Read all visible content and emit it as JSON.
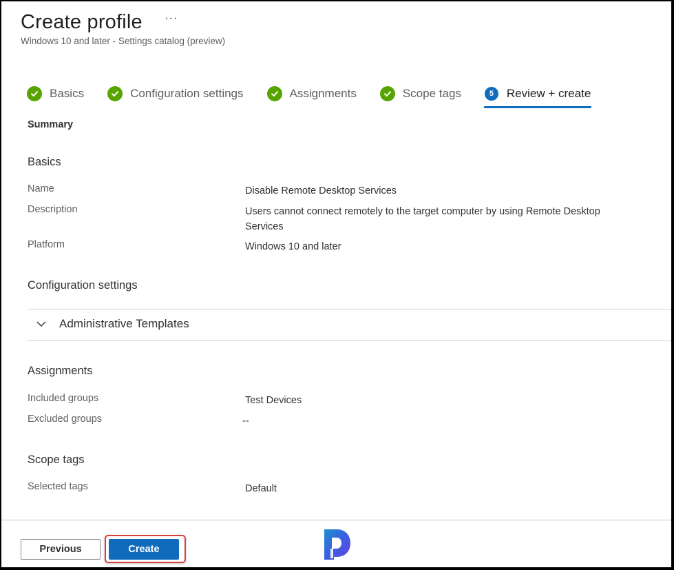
{
  "header": {
    "title": "Create profile",
    "more_label": "···",
    "subtitle": "Windows 10 and later - Settings catalog (preview)"
  },
  "steps": [
    {
      "label": "Basics",
      "status": "complete",
      "icon": "check-circle-icon"
    },
    {
      "label": "Configuration settings",
      "status": "complete",
      "icon": "check-circle-icon"
    },
    {
      "label": "Assignments",
      "status": "complete",
      "icon": "check-circle-icon"
    },
    {
      "label": "Scope tags",
      "status": "complete",
      "icon": "check-circle-icon"
    },
    {
      "label": "Review + create",
      "status": "active",
      "number": "5"
    }
  ],
  "summary_label": "Summary",
  "basics": {
    "title": "Basics",
    "rows": [
      {
        "label": "Name",
        "value": "Disable Remote Desktop Services"
      },
      {
        "label": "Description",
        "value": "Users cannot connect remotely to the target computer by using Remote Desktop Services"
      },
      {
        "label": "Platform",
        "value": "Windows 10 and later"
      }
    ]
  },
  "configuration": {
    "title": "Configuration settings",
    "accordion_label": "Administrative Templates",
    "accordion_icon": "chevron-down-icon"
  },
  "assignments": {
    "title": "Assignments",
    "rows": [
      {
        "label": "Included groups",
        "value": "Test Devices"
      },
      {
        "label": "Excluded groups",
        "value": "--"
      }
    ]
  },
  "scope_tags": {
    "title": "Scope tags",
    "rows": [
      {
        "label": "Selected tags",
        "value": "Default"
      }
    ]
  },
  "footer": {
    "previous_label": "Previous",
    "create_label": "Create"
  },
  "colors": {
    "accent": "#0f6cbd",
    "success": "#57a300",
    "highlight": "#d9403c"
  }
}
